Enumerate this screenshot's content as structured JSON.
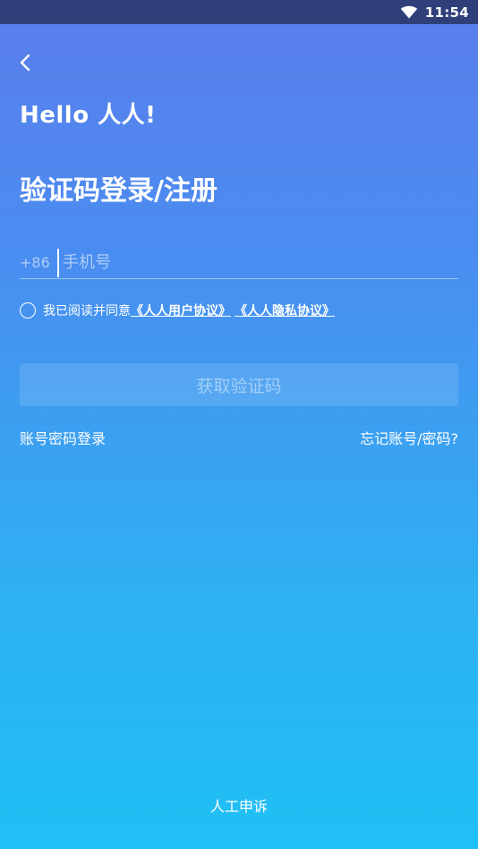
{
  "status_bar": {
    "time": "11:54",
    "icon": "wifi-icon"
  },
  "header": {
    "back_icon": "chevron-left-icon",
    "logo_text": "Hello 人人!"
  },
  "main": {
    "title": "验证码登录/注册",
    "phone": {
      "country_code": "+86",
      "placeholder": "手机号",
      "value": ""
    },
    "agreement": {
      "prefix": "我已阅读并同意",
      "link_user": "《人人用户协议》",
      "link_privacy": "《人人隐私协议》",
      "checked": false
    },
    "get_code_button": "获取验证码",
    "password_login_link": "账号密码登录",
    "forgot_link": "忘记账号/密码?"
  },
  "footer": {
    "appeal_link": "人工申诉"
  },
  "colors": {
    "gradient_top": "#5b7deb",
    "gradient_bottom": "#1fc0f5",
    "status_bar_bg": "#2f3f7a",
    "text": "#ffffff"
  }
}
